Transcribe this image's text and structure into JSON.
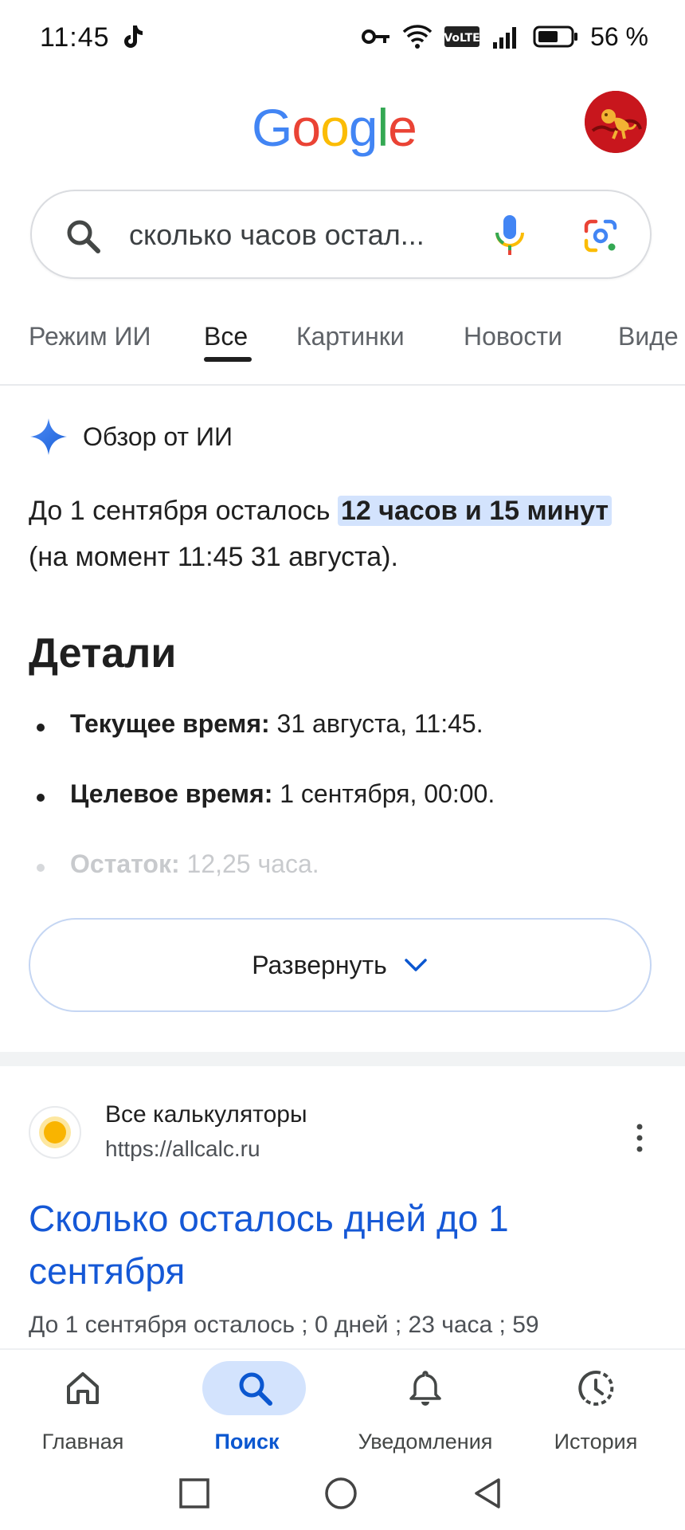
{
  "status_bar": {
    "time": "11:45",
    "battery_percent": "56 %",
    "icons": [
      "tiktok-icon",
      "key-icon",
      "wifi-icon",
      "volte-icon",
      "signal-icon",
      "battery-icon"
    ]
  },
  "header": {
    "logo": [
      "G",
      "o",
      "o",
      "g",
      "l",
      "e"
    ],
    "logo_colors": [
      "#4285F4",
      "#EA4335",
      "#FBBC05",
      "#4285F4",
      "#34A853",
      "#EA4335"
    ]
  },
  "search": {
    "query": "сколько часов остал..."
  },
  "tabs": [
    {
      "label": "Режим ИИ",
      "active": false
    },
    {
      "label": "Все",
      "active": true
    },
    {
      "label": "Картинки",
      "active": false
    },
    {
      "label": "Новости",
      "active": false
    },
    {
      "label": "Виде",
      "active": false
    }
  ],
  "ai_overview": {
    "title": "Обзор от ИИ",
    "answer_prefix": "До 1 сентября осталось ",
    "answer_highlight": "12 часов и 15 минут",
    "answer_suffix": " (на момент 11:45 31 августа).",
    "details_heading": "Детали",
    "details": [
      {
        "label": "Текущее время:",
        "value": " 31 августа, 11:45."
      },
      {
        "label": "Целевое время:",
        "value": " 1 сентября, 00:00."
      },
      {
        "label": "Остаток:",
        "value": " 12,25 часа."
      }
    ],
    "expand_label": "Развернуть"
  },
  "result": {
    "site_name": "Все калькуляторы",
    "url": "https://allcalc.ru",
    "title": "Сколько осталось дней до 1 сентября",
    "snippet": "До 1 сентября осталось ; 0 дней ; 23 часа ; 59"
  },
  "bottom_nav": [
    {
      "label": "Главная",
      "icon": "home-icon",
      "active": false
    },
    {
      "label": "Поиск",
      "icon": "search-icon",
      "active": true
    },
    {
      "label": "Уведомления",
      "icon": "bell-icon",
      "active": false
    },
    {
      "label": "История",
      "icon": "history-icon",
      "active": false
    }
  ],
  "colors": {
    "accent": "#0b57d0",
    "link": "#1558d6",
    "highlight": "#d3e3fd"
  }
}
